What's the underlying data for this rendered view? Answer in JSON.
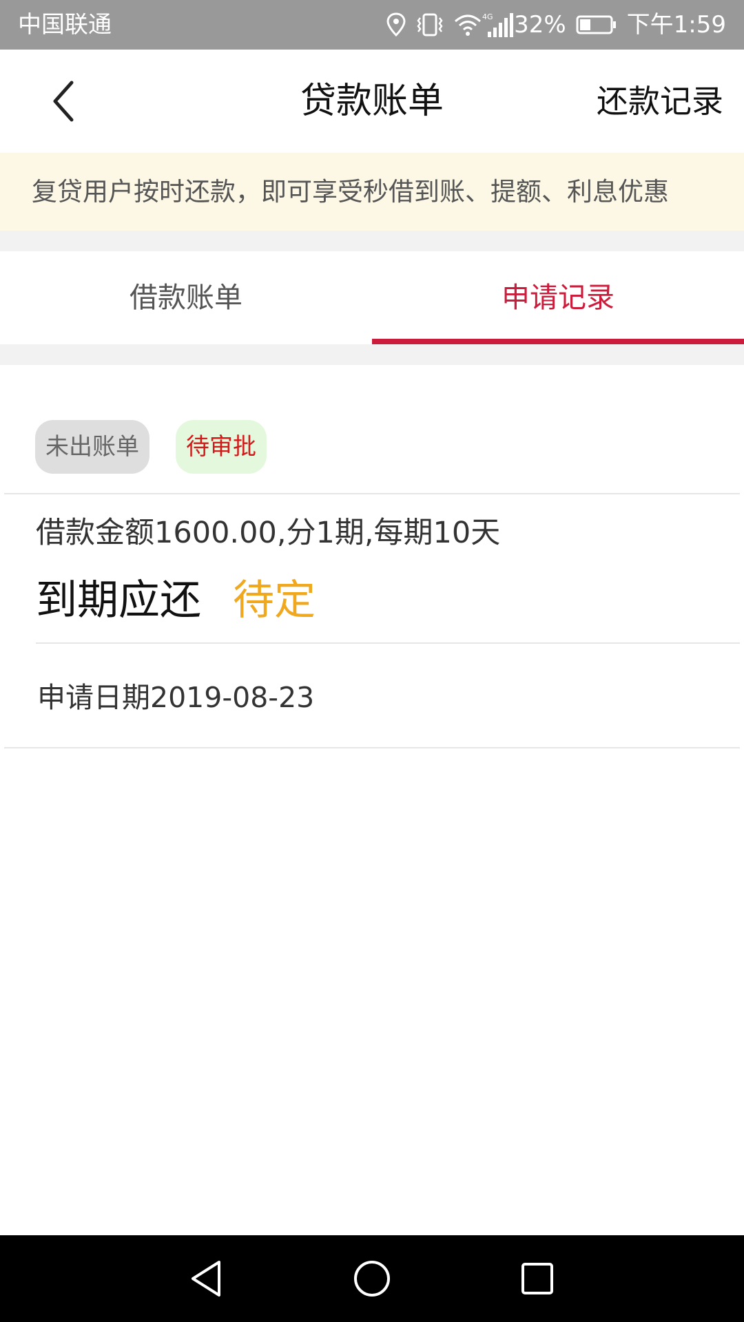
{
  "status_bar": {
    "carrier": "中国联通",
    "network": "4G",
    "battery": "32%",
    "time": "下午1:59",
    "icons": [
      "location-icon",
      "vibrate-icon",
      "wifi-icon",
      "signal-icon",
      "battery-icon"
    ]
  },
  "header": {
    "title": "贷款账单",
    "right_link": "还款记录",
    "back_icon": "chevron-left-icon"
  },
  "notice": {
    "text": "复贷用户按时还款，即可享受秒借到账、提额、利息优惠"
  },
  "tabs": {
    "items": [
      {
        "label": "借款账单",
        "active": false
      },
      {
        "label": "申请记录",
        "active": true
      }
    ],
    "active_color": "#cc1c3c"
  },
  "record": {
    "badges": [
      {
        "label": "未出账单",
        "color": "#666666",
        "background": "#dedede"
      },
      {
        "label": "待审批",
        "color": "#d11a1a",
        "background": "#e4f8de"
      }
    ],
    "loan_info": "借款金额1600.00,分1期,每期10天",
    "due_label": "到期应还",
    "due_value": "待定",
    "due_value_color": "#f0a81e",
    "apply_date": "申请日期2019-08-23"
  },
  "nav_bar": {
    "buttons": [
      "back-triangle-icon",
      "home-circle-icon",
      "recents-square-icon"
    ]
  }
}
